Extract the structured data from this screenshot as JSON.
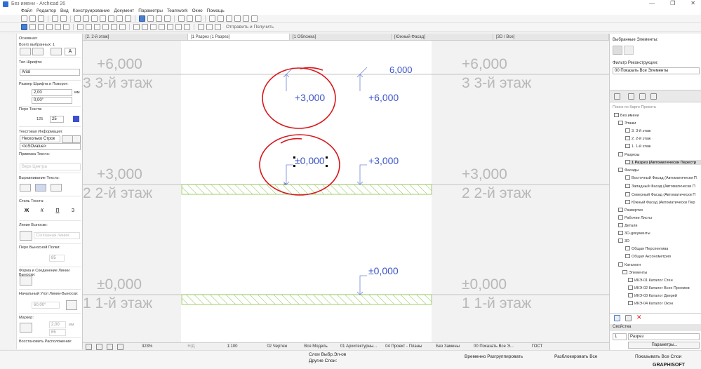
{
  "window": {
    "title": "Без имени - Archicad 26",
    "controls": [
      "—",
      "❐",
      "✕"
    ]
  },
  "menu": [
    "Файл",
    "Редактор",
    "Вид",
    "Конструирование",
    "Документ",
    "Параметры",
    "Teamwork",
    "Окно",
    "Помощь"
  ],
  "toolbar": {
    "publish_label": "Отправить и Получить"
  },
  "left_panel": {
    "basic": "Основная:",
    "selected_count": "Всего выбранных: 1",
    "font_type_label": "Тип Шрифта:",
    "font_value": "Arial",
    "size_label": "Размер Шрифта и Поворот:",
    "size_value": "2,00",
    "size_unit": "мм",
    "rotation_value": "0,00°",
    "pen_label": "Перо Текста:",
    "pen_a": "125",
    "pen_b": "25",
    "text_info_label": "Текстовая Информация:",
    "text_mode": "Несколько Строк",
    "text_value": "<toSOvalue>",
    "anchor_label": "Привязка Текста:",
    "anchor_value": "Верх Центра",
    "align_label": "Выравнивание Текста:",
    "style_label": "Стиль Текста:",
    "style_buttons": [
      "Ж",
      "К",
      "П",
      "З"
    ],
    "leader_label": "Линия Выноски:",
    "leader_value": "Сплошная линия",
    "leader_pen_label": "Перо Выносной Полки:",
    "leader_pen_value": "85",
    "shape_label": "Форма и Соединение Линии Выноски:",
    "angle_label": "Начальный Угол Линии-Выноски:",
    "angle_value": "60,00°",
    "marker_label": "Маркер:",
    "marker_size": "2,00",
    "marker_unit": "мм",
    "marker_pen": "65",
    "restore_label": "Восстановить Расположение:"
  },
  "tabs": [
    "[2. 2-й этаж]",
    "[1 Разрез (1 Разрез]",
    "[1 Обложка]",
    "[Южный Фасад]",
    "[3D / Все]"
  ],
  "canvas": {
    "story3_level": "+6,000",
    "story3_name": "3 3-й этаж",
    "story2_level": "+3,000",
    "story2_name": "2 2-й этаж",
    "story1_level": "±0,000",
    "story1_name": "1 1-й этаж",
    "marker_6000_top": "6,000",
    "marker_plus3000_a": "+3,000",
    "marker_plus6000": "+6,000",
    "marker_zero_selected": "±0,000",
    "marker_plus3000_b": "+3,000",
    "marker_zero_b": "±0,000"
  },
  "status": {
    "zoom": "323%",
    "angle": "Н/Д",
    "scale": "1:100",
    "layer_combo": "02 Чертеж",
    "model": "Вся Модель",
    "arch": "01 Архитектурны...",
    "project": "04 Проект - Планы",
    "renovation": "Без Замены",
    "show_all": "00 Показать Все Э...",
    "gost": "ГОСТ"
  },
  "bottom": {
    "layers": "Слои Выбр.Эл-ов",
    "current_layers": "Другие Слои:",
    "temporary": "Временно Разгруппировать",
    "ungroup": "Разблокировать Все",
    "show_all": "Показывать Все Слои",
    "brand": "GRAPHISOFT"
  },
  "right_panel": {
    "selected_header": "Выбранные Элементы:",
    "renovation_label": "Фильтр Реконструкции:",
    "renovation_value": "00 Показать Все Элементы",
    "search_placeholder": "Поиск по Карте Проекта",
    "tree": [
      "Без имени",
      "Этажи",
      "3. 3-й этаж",
      "2. 2-й этаж",
      "1. 1-й этаж",
      "Разрезы",
      "1 Разрез (Автоматически Перестр",
      "Фасады",
      "Восточный Фасад (Автоматически П",
      "Западный Фасад (Автоматически П",
      "Северный Фасад (Автоматически П",
      "Южный Фасад (Автоматически Пер",
      "Развертки",
      "Рабочие Листы",
      "Детали",
      "3D-документы",
      "3D",
      "Общая Перспектива",
      "Общая Аксонометрия",
      "Каталоги",
      "Элементы",
      "ИКЭ-01 Каталог Стен",
      "ИКЭ-02 Каталог Всех Проемов",
      "ИКЭ-03 Каталог Дверей",
      "ИКЭ-04 Каталог Окон"
    ],
    "properties_label": "Свойства",
    "prop_id": "1",
    "prop_value": "Разрез",
    "params_button": "Параметры..."
  },
  "annotation_color": "#d9161a",
  "accent": "#3b55c8"
}
